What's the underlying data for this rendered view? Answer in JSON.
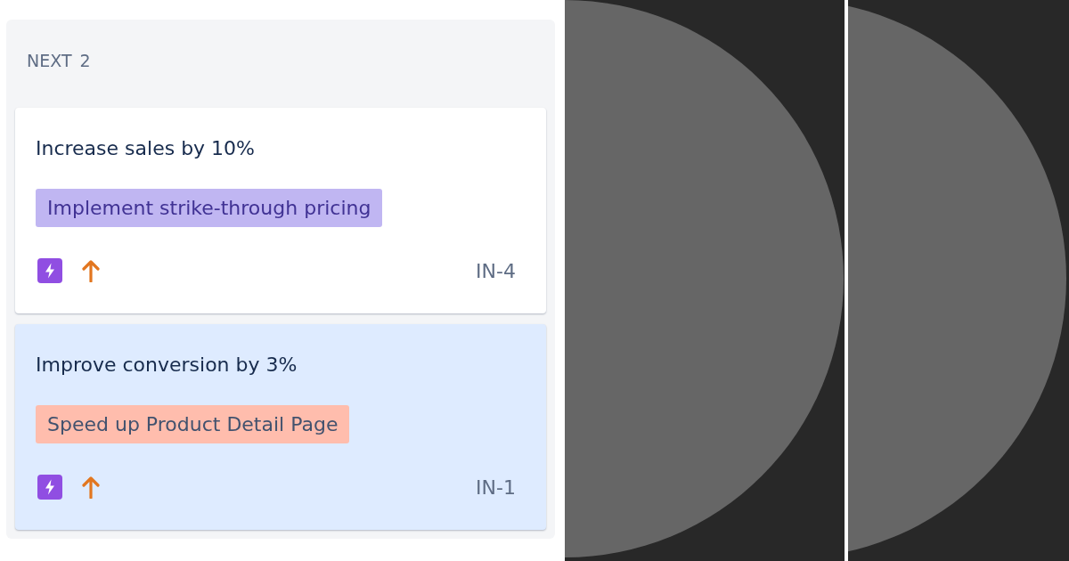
{
  "column": {
    "title": "NEXT",
    "count": "2"
  },
  "cards": [
    {
      "title": "Increase sales by 10%",
      "epic": {
        "label": "Implement strike-through pricing",
        "color": "#c0b6f2"
      },
      "key": "IN-4",
      "selected": false
    },
    {
      "title": "Improve conversion by 3%",
      "epic": {
        "label": "Speed up Product Detail Page",
        "color": "#ffbdad"
      },
      "key": "IN-1",
      "selected": true
    }
  ]
}
